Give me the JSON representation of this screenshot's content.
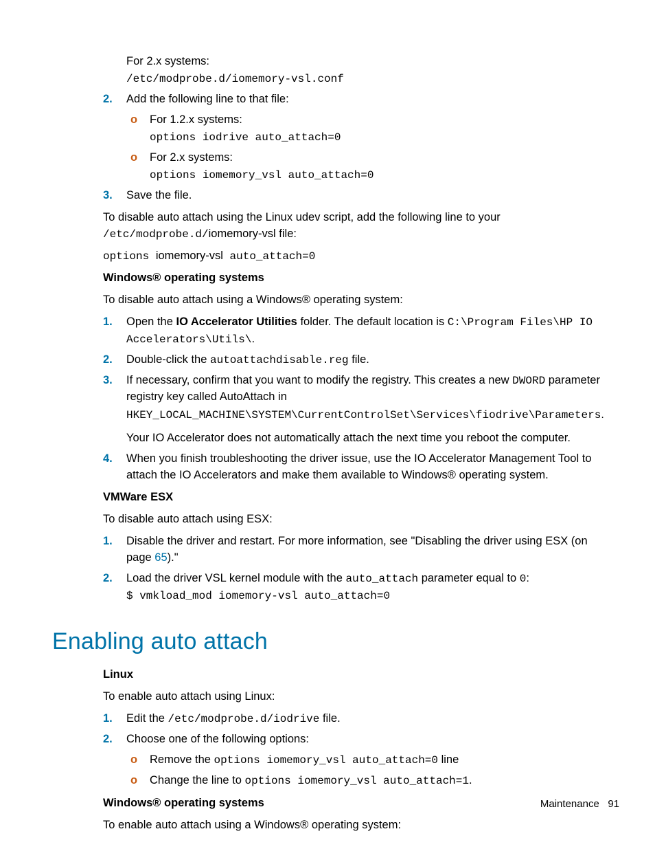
{
  "top": {
    "line1": "For 2.x systems:",
    "code1": "/etc/modprobe.d/iomemory-vsl.conf"
  },
  "step2": {
    "text": "Add the following line to that file:",
    "sub1_label": "For 1.2.x systems:",
    "sub1_code": "options iodrive auto_attach=0",
    "sub2_label": "For 2.x systems:",
    "sub2_code": "options iomemory_vsl auto_attach=0"
  },
  "step3": "Save the file.",
  "afterSteps": {
    "p1_prefix": "To disable auto attach using the Linux udev script, add the following line to your ",
    "p1_code": "/etc/modprobe.d/",
    "p1_suffix": "iomemory-vsl file:",
    "p2_code_a": "options ",
    "p2_mid": "iomemory-vsl",
    "p2_code_b": " auto_attach=0"
  },
  "winHeading": "Windows® operating systems",
  "winIntro": "To disable auto attach using a Windows® operating system:",
  "winSteps": {
    "s1_a": "Open the ",
    "s1_bold": "IO Accelerator Utilities",
    "s1_b": " folder. The default location is ",
    "s1_code": "C:\\Program Files\\HP IO Accelerators\\Utils\\",
    "s1_end": ".",
    "s2_a": "Double-click the ",
    "s2_code": "autoattachdisable.reg",
    "s2_b": " file.",
    "s3_a": "If necessary, confirm that you want to modify the registry. This creates a new ",
    "s3_code1": "DWORD",
    "s3_b": " parameter registry key called AutoAttach in",
    "s3_code2": "HKEY_LOCAL_MACHINE\\SYSTEM\\CurrentControlSet\\Services\\fiodrive\\Parameters",
    "s3_end": ".",
    "s3_p2": "Your IO Accelerator does not automatically attach the next time you reboot the computer.",
    "s4": "When you finish troubleshooting the driver issue, use the IO Accelerator Management Tool to attach the IO Accelerators and make them available to Windows® operating system."
  },
  "vmHeading": "VMWare ESX",
  "vmIntro": "To disable auto attach using ESX:",
  "vmSteps": {
    "s1_a": "Disable the driver and restart. For more information, see \"Disabling the driver using ESX (on page ",
    "s1_link": "65",
    "s1_b": ").\"",
    "s2_a": "Load the driver VSL kernel module with the ",
    "s2_code1": "auto_attach",
    "s2_b": " parameter equal to ",
    "s2_code2": "0",
    "s2_c": ":",
    "s2_cmd": "$ vmkload_mod iomemory-vsl auto_attach=0"
  },
  "h1": "Enabling auto attach",
  "linuxHeading": "Linux",
  "linuxIntro": "To enable auto attach using Linux:",
  "linuxSteps": {
    "s1_a": "Edit the ",
    "s1_code": "/etc/modprobe.d/iodrive",
    "s1_b": " file.",
    "s2": "Choose one of the following options:",
    "s2_sub1_a": "Remove the ",
    "s2_sub1_code": "options iomemory_vsl auto_attach=0",
    "s2_sub1_b": " line",
    "s2_sub2_a": "Change the line to ",
    "s2_sub2_code": "options iomemory_vsl auto_attach=1",
    "s2_sub2_b": "."
  },
  "winHeading2": "Windows® operating systems",
  "winIntro2": "To enable auto attach using a Windows® operating system:",
  "footer": {
    "section": "Maintenance",
    "page": "91"
  }
}
